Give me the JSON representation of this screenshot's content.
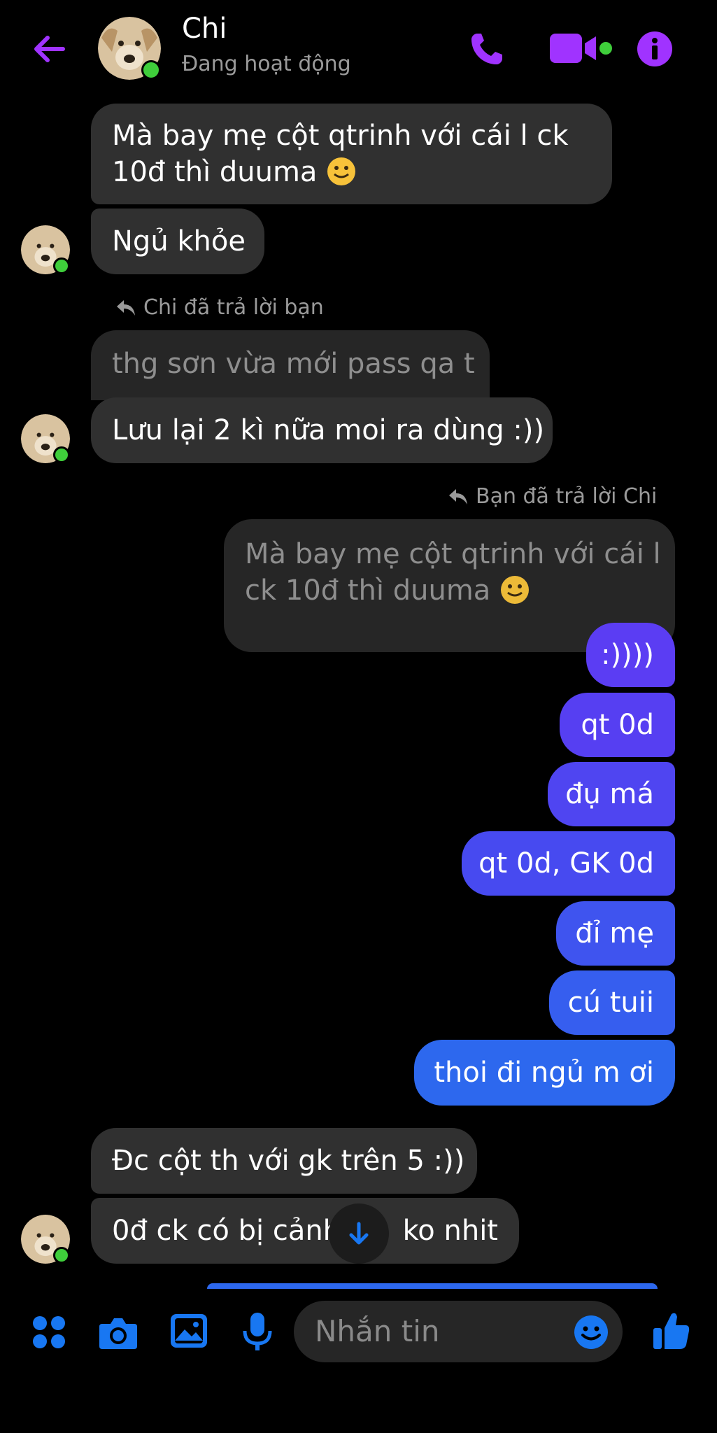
{
  "header": {
    "contact_name": "Chi",
    "status": "Đang hoạt động",
    "accent_color": "#a033ff"
  },
  "messages": {
    "m1": "Mà bay mẹ cột qtrinh với cái l ck",
    "m1b": "10đ thì duuma",
    "m2": "Ngủ khỏe",
    "reply1_hint": "Chi đã trả lời bạn",
    "m3_quote": "thg sơn vừa mới pass qa t",
    "m3": "Lưu lại 2 kì nữa moi ra dùng :))",
    "reply2_hint": "Bạn đã trả lời Chi",
    "q2_line1": "Mà bay mẹ cột qtrinh với cái l",
    "q2_line2": "ck 10đ thì duuma",
    "o1": ":))))",
    "o2": "qt 0d",
    "o3": "đụ má",
    "o4": "qt 0d, GK 0d",
    "o5": "đỉ mẹ",
    "o6": "cú tuii",
    "o7": "thoi đi ngủ m ơi",
    "m4": "Đc cột th với gk trên 5 :))",
    "m5_left": "0đ ck có bị cảnh",
    "m5_right": "ko nhit"
  },
  "composer": {
    "placeholder": "Nhắn tin"
  },
  "icons": {
    "back": "back-arrow-icon",
    "call": "phone-icon",
    "video": "video-icon",
    "info": "info-icon",
    "apps": "apps-grid-icon",
    "camera": "camera-icon",
    "gallery": "image-icon",
    "mic": "microphone-icon",
    "emoji": "emoji-icon",
    "like": "thumbs-up-icon",
    "scroll_down": "arrow-down-icon"
  },
  "colors": {
    "header_icons": "#a033ff",
    "composer_icons": "#1877f2",
    "outgoing_top": "#5b3ef5",
    "outgoing_bottom": "#2b6cf0",
    "incoming": "#303030"
  }
}
